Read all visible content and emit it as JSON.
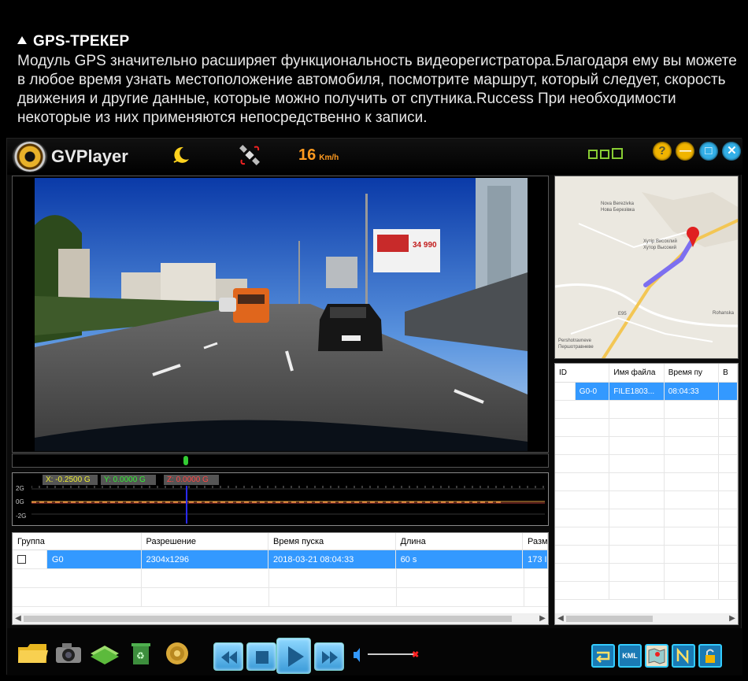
{
  "header": {
    "title": "GPS-ТРЕКЕР",
    "description": "Модуль GPS значительно расширяет функциональность видеорегистратора.Благодаря ему вы можете в любое время узнать местоположение автомобиля, посмотрите маршрут, который следует, скорость движения и другие данные, которые можно получить от спутника.Ruccess При необходимости некоторые из них применяются непосредственно к записи."
  },
  "app": {
    "name": "GVPlayer",
    "speed_value": "16",
    "speed_unit": "Km/h",
    "window_buttons": {
      "help": "?",
      "minimize": "—",
      "maximize": "□",
      "close": "✕"
    }
  },
  "video": {
    "billboard_text": "34 990"
  },
  "gsensor": {
    "x_label": "X: -0.2500 G",
    "y_label": "Y: 0.0000 G",
    "z_label": "Z: 0.0000 G",
    "axis_top": "2G",
    "axis_mid": "0G",
    "axis_bottom": "-2G",
    "colors": {
      "x": "#ee3",
      "y": "#3e3",
      "z": "#f44"
    }
  },
  "file_table": {
    "columns": [
      "Группа",
      "Разрешение",
      "Время пуска",
      "Длина",
      "Разме"
    ],
    "rows": [
      {
        "group": "G0",
        "resolution": "2304x1296",
        "start": "2018-03-21 08:04:33",
        "length": "60 s",
        "size": "173 I"
      }
    ]
  },
  "map": {
    "labels": {
      "place1": "Nova Berezivka",
      "place2": "Нова Березівка",
      "place3": "Хутір Висохлий",
      "place4": "Хутор Высокий",
      "road": "E95",
      "place5": "Pershotravneve",
      "place6": "Першотравневе",
      "place7": "Rohanska"
    }
  },
  "right_table": {
    "columns": [
      "ID",
      "Имя файла",
      "Время пу",
      "В"
    ],
    "rows": [
      {
        "id": "G0-0",
        "file": "FILE1803...",
        "time": "08:04:33"
      }
    ]
  },
  "controls": {
    "kml_label": "KML"
  }
}
